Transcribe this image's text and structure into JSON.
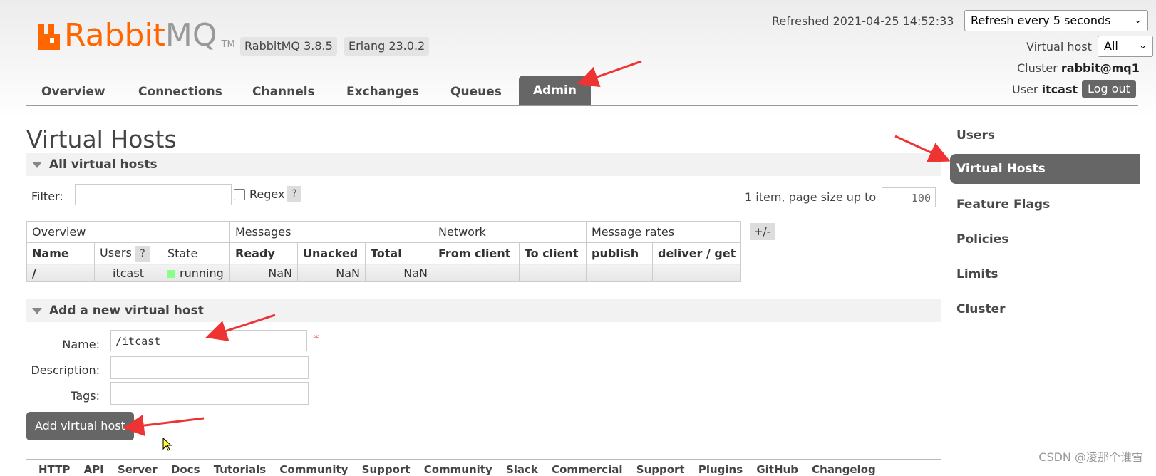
{
  "header": {
    "logo_text_main": "Rabbit",
    "logo_text_mq": "MQ",
    "logo_tm": "TM",
    "version_badge": "RabbitMQ 3.8.5",
    "erlang_badge": "Erlang 23.0.2",
    "refreshed": "Refreshed 2021-04-25 14:52:33",
    "refresh_select": "Refresh every 5 seconds",
    "vhost_label": "Virtual host",
    "vhost_select": "All",
    "cluster_label": "Cluster",
    "cluster_value": "rabbit@mq1",
    "user_label": "User",
    "user_value": "itcast",
    "logout": "Log out"
  },
  "tabs": [
    "Overview",
    "Connections",
    "Channels",
    "Exchanges",
    "Queues",
    "Admin"
  ],
  "page_title": "Virtual Hosts",
  "all_vhosts": {
    "section_title": "All virtual hosts",
    "filter_label": "Filter:",
    "regex_label": "Regex",
    "help": "?",
    "page_info": "1 item, page size up to",
    "page_size": "100",
    "plusminus": "+/-",
    "group_headers": [
      "Overview",
      "Messages",
      "Network",
      "Message rates"
    ],
    "column_headers": [
      "Name",
      "Users",
      "State",
      "Ready",
      "Unacked",
      "Total",
      "From client",
      "To client",
      "publish",
      "deliver / get"
    ],
    "row": {
      "name": "/",
      "users": "itcast",
      "state": "running",
      "ready": "NaN",
      "unacked": "NaN",
      "total": "NaN"
    }
  },
  "add_vhost": {
    "section_title": "Add a new virtual host",
    "name_label": "Name:",
    "name_value": "/itcast",
    "required": "*",
    "description_label": "Description:",
    "tags_label": "Tags:",
    "submit": "Add virtual host"
  },
  "footer_links": "HTTP API  Server Docs  Tutorials  Community Support  Community Slack  Commercial Support  Plugins  GitHub  Changelog",
  "sidebar": [
    "Users",
    "Virtual Hosts",
    "Feature Flags",
    "Policies",
    "Limits",
    "Cluster"
  ],
  "watermark": "CSDN @凌那个谁雪",
  "colors": {
    "brand_orange": "#ff6600",
    "active_tab": "#666666",
    "annotation_arrow": "#ee3333"
  }
}
